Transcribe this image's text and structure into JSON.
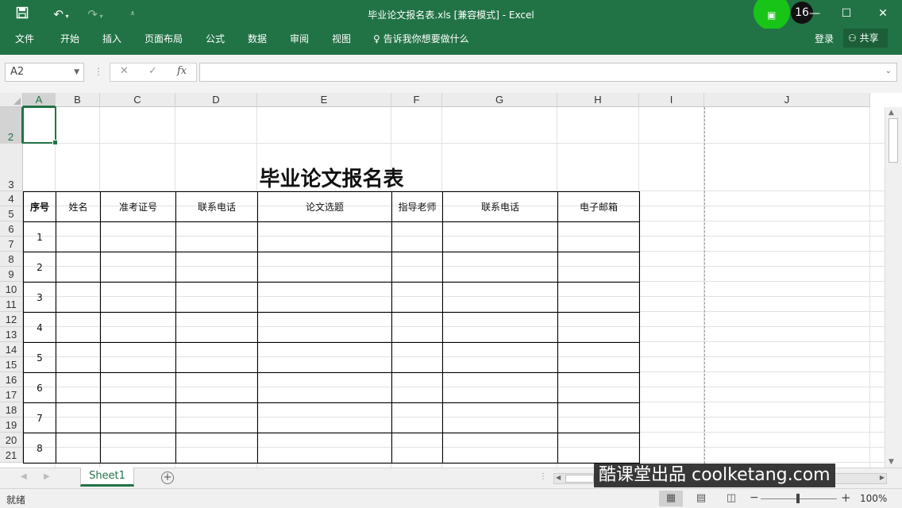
{
  "window": {
    "title": "毕业论文报名表.xls  [兼容模式] - Excel",
    "badge_count": "16",
    "accent_color": "#217346"
  },
  "quick_access": {
    "icons": [
      "save-icon",
      "undo-icon",
      "redo-icon",
      "customize-icon"
    ]
  },
  "ribbon": {
    "tabs": [
      "文件",
      "开始",
      "插入",
      "页面布局",
      "公式",
      "数据",
      "审阅",
      "视图"
    ],
    "tell_me": "告诉我你想要做什么",
    "login": "登录",
    "share": "共享"
  },
  "formula_bar": {
    "name_box": "A2",
    "fx": "fx",
    "value": ""
  },
  "grid": {
    "columns": [
      "A",
      "B",
      "C",
      "D",
      "E",
      "F",
      "G",
      "H",
      "I",
      "J"
    ],
    "selected_column": "A",
    "rows": [
      "2",
      "3",
      "4",
      "5",
      "6",
      "7",
      "8",
      "9",
      "10",
      "11",
      "12",
      "13",
      "14",
      "15",
      "16",
      "17",
      "18",
      "19",
      "20",
      "21"
    ],
    "selected_row": "2"
  },
  "sheet": {
    "title": "毕业论文报名表",
    "headers": [
      "序号",
      "姓名",
      "准考证号",
      "联系电话",
      "论文选题",
      "指导老师",
      "联系电话",
      "电子邮箱"
    ],
    "serials": [
      "1",
      "2",
      "3",
      "4",
      "5",
      "6",
      "7",
      "8"
    ]
  },
  "tabs_bar": {
    "sheet_name": "Sheet1",
    "add_icon": "plus-icon"
  },
  "watermark": "酷课堂出品 coolketang.com",
  "status_bar": {
    "status": "就绪",
    "zoom": "100%"
  }
}
